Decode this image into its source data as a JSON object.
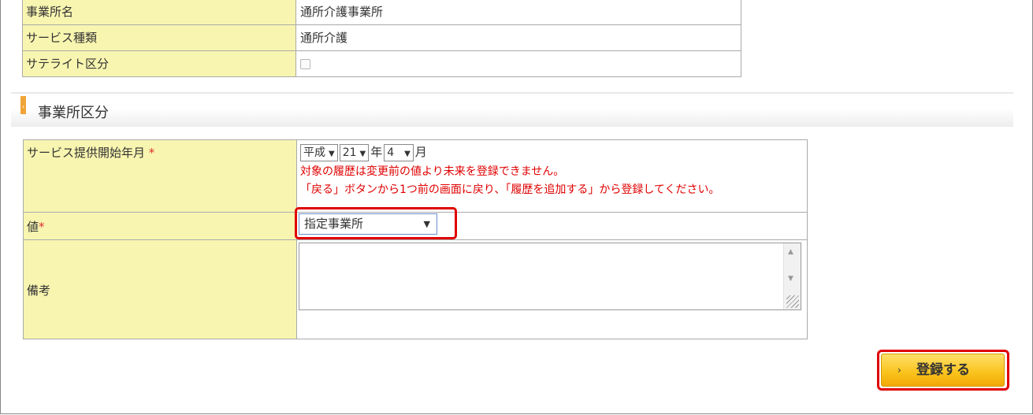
{
  "office_info": {
    "rows": [
      {
        "label": "事業所名",
        "value": "通所介護事業所"
      },
      {
        "label": "サービス種類",
        "value": "通所介護"
      },
      {
        "label": "サテライト区分",
        "value": ""
      }
    ]
  },
  "section": {
    "title": "事業所区分"
  },
  "form": {
    "start_date_label": "サービス提供開始年月",
    "required_mark": "*",
    "era": "平成",
    "year": "21",
    "year_unit": "年",
    "month": "4",
    "month_unit": "月",
    "error_line1": "対象の履歴は変更前の値より未来を登録できません。",
    "error_line2": "「戻る」ボタンから1つ前の画面に戻り、「履歴を追加する」から登録してください。",
    "value_label": "値",
    "value_selected": "指定事業所",
    "note_label": "備考",
    "note_value": ""
  },
  "actions": {
    "register_label": "登録する"
  },
  "colors": {
    "label_bg": "#f8f5b0",
    "accent": "#f0a437",
    "error": "#e00000",
    "button": "#f9c21a"
  },
  "icons": [
    "dropdown-arrow-icon",
    "chevron-right-icon",
    "scroll-up-icon",
    "scroll-down-icon",
    "resize-grip-icon"
  ]
}
